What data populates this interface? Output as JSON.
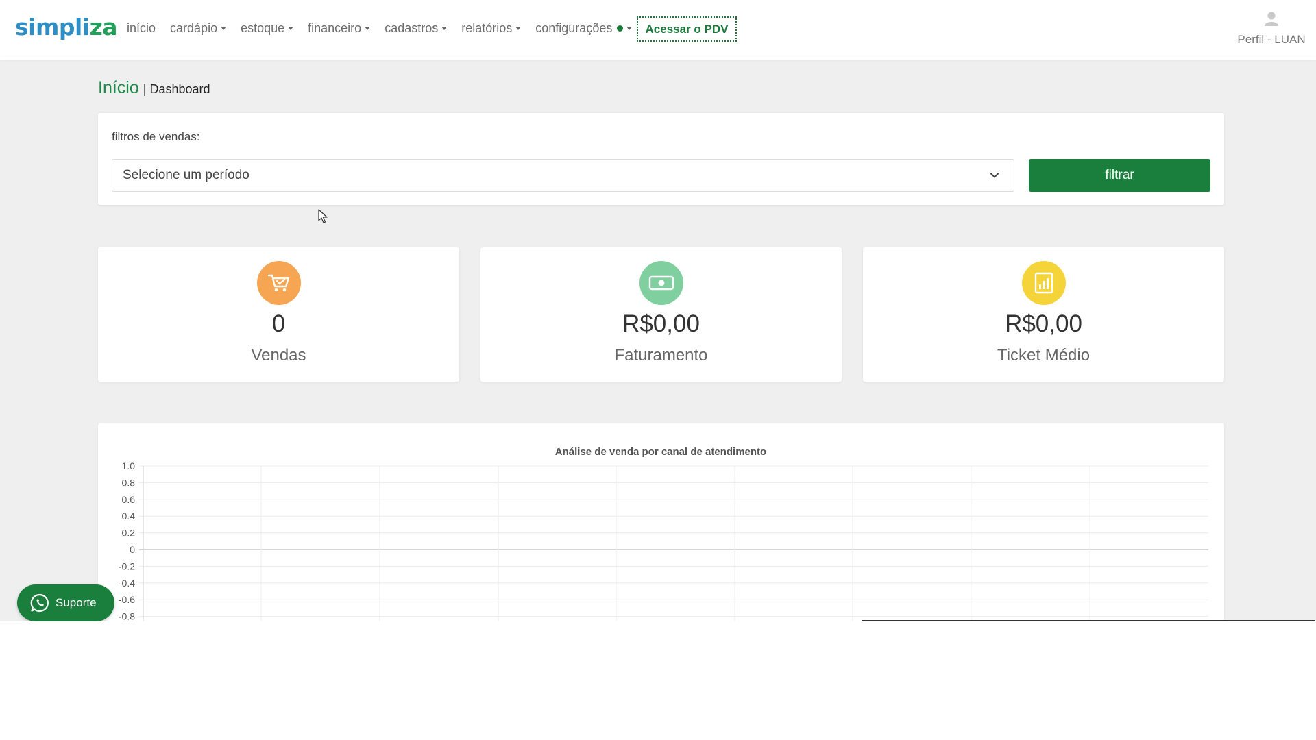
{
  "nav": {
    "logo_prefix": "simpli",
    "logo_suffix": "za",
    "items": [
      {
        "label": "início",
        "dropdown": false
      },
      {
        "label": "cardápio",
        "dropdown": true
      },
      {
        "label": "estoque",
        "dropdown": true
      },
      {
        "label": "financeiro",
        "dropdown": true
      },
      {
        "label": "cadastros",
        "dropdown": true
      },
      {
        "label": "relatórios",
        "dropdown": true
      },
      {
        "label": "configurações",
        "dropdown": true
      }
    ],
    "pdv_button": "Acessar o PDV",
    "profile_label": "Perfil - LUAN"
  },
  "breadcrumb": {
    "home": "Início",
    "separator": "|",
    "current": "Dashboard"
  },
  "filter": {
    "label": "filtros de vendas:",
    "select_value": "Selecione um período",
    "button": "filtrar"
  },
  "stats": [
    {
      "value": "0",
      "label": "Vendas",
      "icon": "cart-icon",
      "color": "#f6a552"
    },
    {
      "value": "R$0,00",
      "label": "Faturamento",
      "icon": "money-icon",
      "color": "#7fcf9f"
    },
    {
      "value": "R$0,00",
      "label": "Ticket Médio",
      "icon": "chart-bar-icon",
      "color": "#f5d43a"
    }
  ],
  "colors": {
    "primary": "#1a7f3c",
    "logo_blue": "#2f8fc4",
    "logo_green": "#22a05a"
  },
  "chart_data": {
    "type": "bar",
    "title": "Análise de venda por canal de atendimento",
    "categories": [],
    "series": [],
    "ylim": [
      -0.8,
      1.0
    ],
    "yticks": [
      "1.0",
      "0.8",
      "0.6",
      "0.4",
      "0.2",
      "0",
      "-0.2",
      "-0.4",
      "-0.6",
      "-0.8"
    ],
    "grid": true
  },
  "support": {
    "label": "Suporte"
  }
}
